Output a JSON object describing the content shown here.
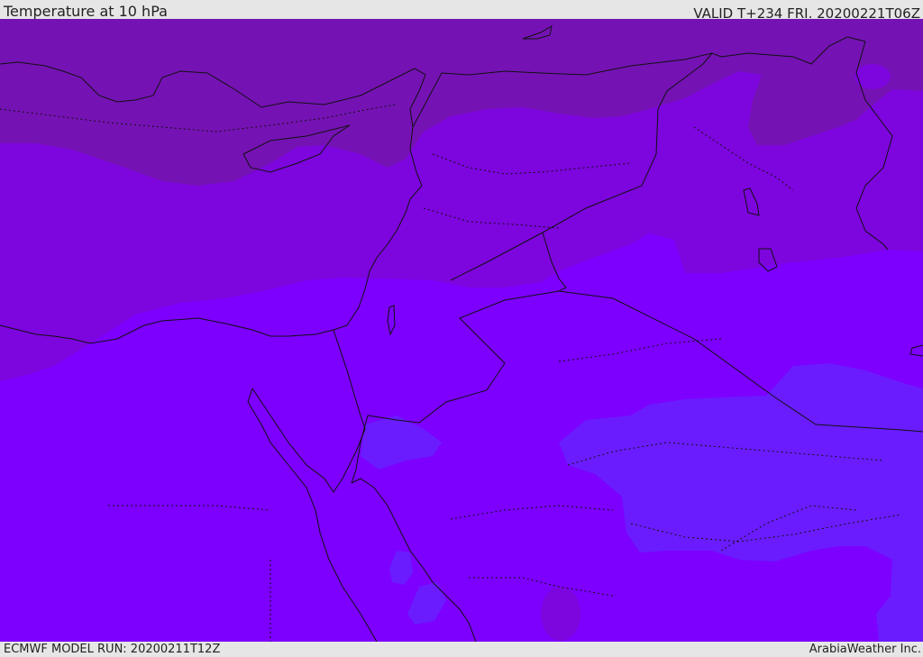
{
  "header": {
    "title": "Temperature at 10 hPa",
    "valid_time": "VALID T+234 FRI. 20200221T06Z"
  },
  "footer": {
    "model_run": "ECMWF MODEL RUN: 20200211T12Z",
    "credit": "ArabiaWeather Inc."
  },
  "map": {
    "colors": {
      "band_dark": "#7512b4",
      "band_mid": "#7d05dd",
      "band_light": "#7d00ff",
      "band_blue": "#6a1cff",
      "band_blue_light": "#6f20ff",
      "coast": "#111111"
    }
  }
}
